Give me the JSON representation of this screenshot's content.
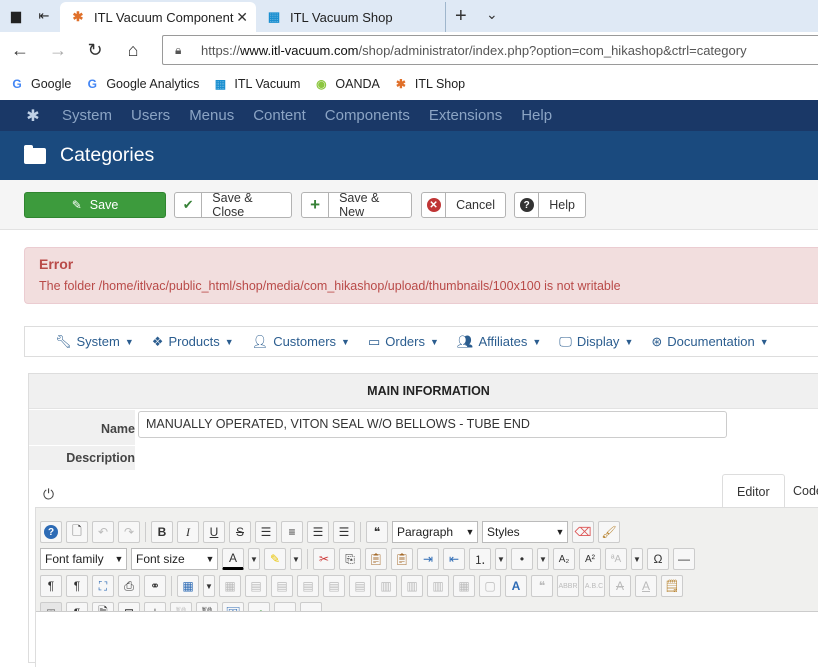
{
  "browser": {
    "tabs": [
      {
        "title": "ITL Vacuum Component",
        "active": true
      },
      {
        "title": "ITL Vacuum Shop",
        "active": false
      }
    ],
    "url_prefix": "https://",
    "url_domain": "www.itl-vacuum.com",
    "url_path": "/shop/administrator/index.php?option=com_hikashop&ctrl=category",
    "bookmarks": [
      "Google",
      "Google Analytics",
      "ITL Vacuum",
      "OANDA",
      "ITL Shop"
    ]
  },
  "admin": {
    "menu": [
      "System",
      "Users",
      "Menus",
      "Content",
      "Components",
      "Extensions",
      "Help"
    ],
    "page_title": "Categories",
    "toolbar": {
      "save": "Save",
      "save_close": "Save & Close",
      "save_new": "Save & New",
      "cancel": "Cancel",
      "help": "Help"
    },
    "error": {
      "heading": "Error",
      "message": "The folder /home/itlvac/public_html/shop/media/com_hikashop/upload/thumbnails/100x100 is not writable"
    },
    "hikamenu": [
      "System",
      "Products",
      "Customers",
      "Orders",
      "Affiliates",
      "Display",
      "Documentation"
    ]
  },
  "form": {
    "section_title": "MAIN INFORMATION",
    "name_label": "Name",
    "name_value": "MANUALLY OPERATED, VITON SEAL W/O BELLOWS - TUBE END",
    "description_label": "Description",
    "editor_tabs": [
      "Editor",
      "Code"
    ],
    "format_select": "Paragraph",
    "styles_select": "Styles",
    "font_family_select": "Font family",
    "font_size_select": "Font size"
  },
  "colors": {
    "topmenu_bg": "#1a3867",
    "titlebar_bg": "#1a4a7e",
    "save_green": "#3d9b3d",
    "error_bg": "#f2dede",
    "error_text": "#b94a48"
  }
}
